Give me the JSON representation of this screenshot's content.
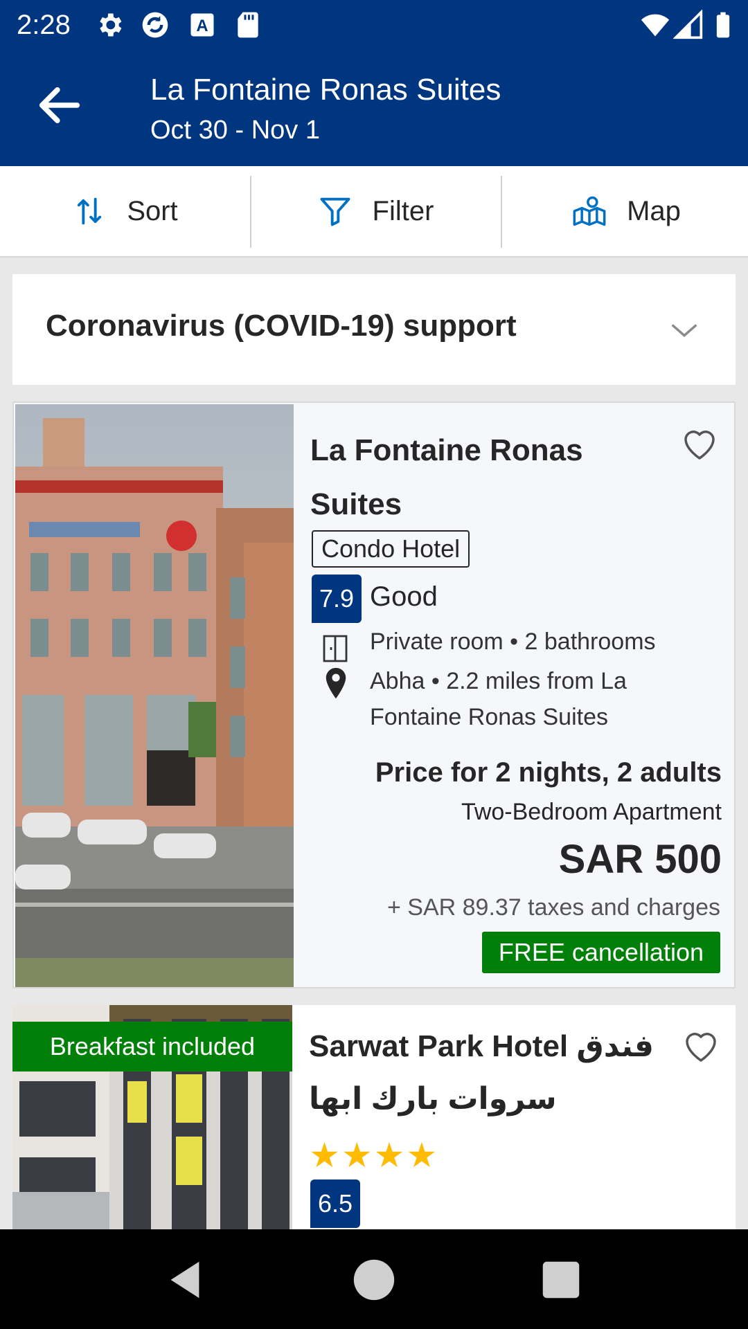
{
  "status_bar": {
    "time": "2:28",
    "icons": [
      "gear-icon",
      "sync-icon",
      "font-a-icon",
      "sd-card-icon",
      "wifi-icon",
      "signal-icon",
      "battery-icon"
    ]
  },
  "app_bar": {
    "title": "La Fontaine Ronas Suites",
    "subtitle": "Oct 30 - Nov 1",
    "back_icon": "arrow-left-icon"
  },
  "actions": {
    "sort": "Sort",
    "filter": "Filter",
    "map": "Map"
  },
  "covid_banner": {
    "label": "Coronavirus (COVID-19) support"
  },
  "properties": [
    {
      "name": "La Fontaine Ronas Suites",
      "type": "Condo Hotel",
      "score": "7.9",
      "score_word": "Good",
      "room_info": "Private room • 2 bathrooms",
      "location": "Abha • 2.2 miles from La Fontaine Ronas Suites",
      "price_label": "Price for 2 nights, 2 adults",
      "room_type": "Two-Bedroom Apartment",
      "price": "SAR 500",
      "taxes": "+ SAR 89.37 taxes and charges",
      "badge": "FREE cancellation"
    },
    {
      "name": "Sarwat Park Hotel فندق سروات بارك ابها",
      "tag": "Breakfast included",
      "stars": "★★★★",
      "score": "6.5"
    }
  ],
  "colors": {
    "brand_blue": "#003580",
    "green": "#008009",
    "star_yellow": "#febb02"
  }
}
